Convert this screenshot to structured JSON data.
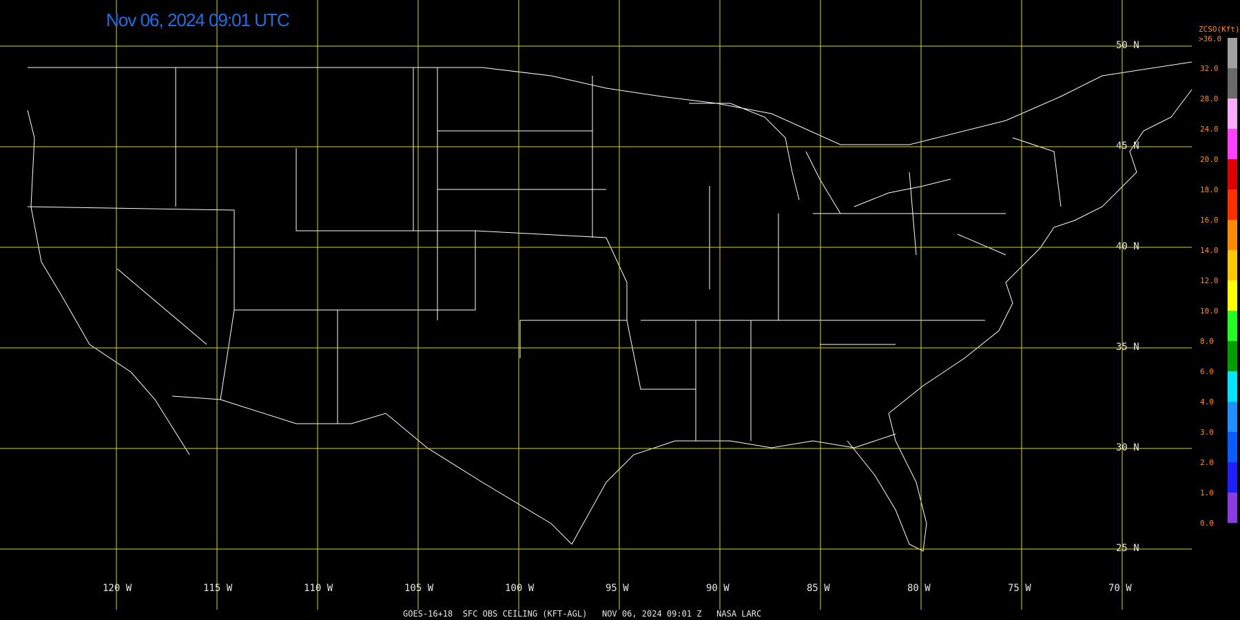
{
  "title": "Nov 06, 2024 09:01 UTC",
  "footer": "GOES-16+18  SFC OBS CEILING (KFT-AGL)   NOV 06, 2024 09:01 Z   NASA LARC",
  "legend": {
    "title": "ZCSO(Kft)",
    "top_label": ">36.0",
    "ticks": [
      "0.0",
      "1.0",
      "2.0",
      "3.0",
      "4.0",
      "6.0",
      "8.0",
      "10.0",
      "12.0",
      "14.0",
      "16.0",
      "18.0",
      "20.0",
      "24.0",
      "28.0",
      "32.0"
    ],
    "colors": [
      "#8a3be2",
      "#1f1fff",
      "#0a5cff",
      "#1e90ff",
      "#00e5ff",
      "#00a000",
      "#22ff22",
      "#ffff00",
      "#ffc800",
      "#ff8c00",
      "#ff3000",
      "#e00000",
      "#ff40ff",
      "#ffaaff",
      "#6a6a6a",
      "#a0a0a0"
    ]
  },
  "grid": {
    "latitudes": [
      {
        "label": "50 N",
        "lat": 50
      },
      {
        "label": "45 N",
        "lat": 45
      },
      {
        "label": "40 N",
        "lat": 40
      },
      {
        "label": "35 N",
        "lat": 35
      },
      {
        "label": "30 N",
        "lat": 30
      },
      {
        "label": "25 N",
        "lat": 25
      }
    ],
    "longitudes": [
      {
        "label": "120 W",
        "lon": -120
      },
      {
        "label": "115 W",
        "lon": -115
      },
      {
        "label": "110 W",
        "lon": -110
      },
      {
        "label": "105 W",
        "lon": -105
      },
      {
        "label": "100 W",
        "lon": -100
      },
      {
        "label": "95 W",
        "lon": -95
      },
      {
        "label": "90 W",
        "lon": -90
      },
      {
        "label": "85 W",
        "lon": -85
      },
      {
        "label": "80 W",
        "lon": -80
      },
      {
        "label": "75 W",
        "lon": -75
      },
      {
        "label": "70 W",
        "lon": -70
      }
    ],
    "line_color": "#d8d820"
  },
  "colors": {
    "background": "#000000",
    "boundary": "#ffffff",
    "title": "#1f6fe0",
    "legend_text": "#ff8c00"
  }
}
